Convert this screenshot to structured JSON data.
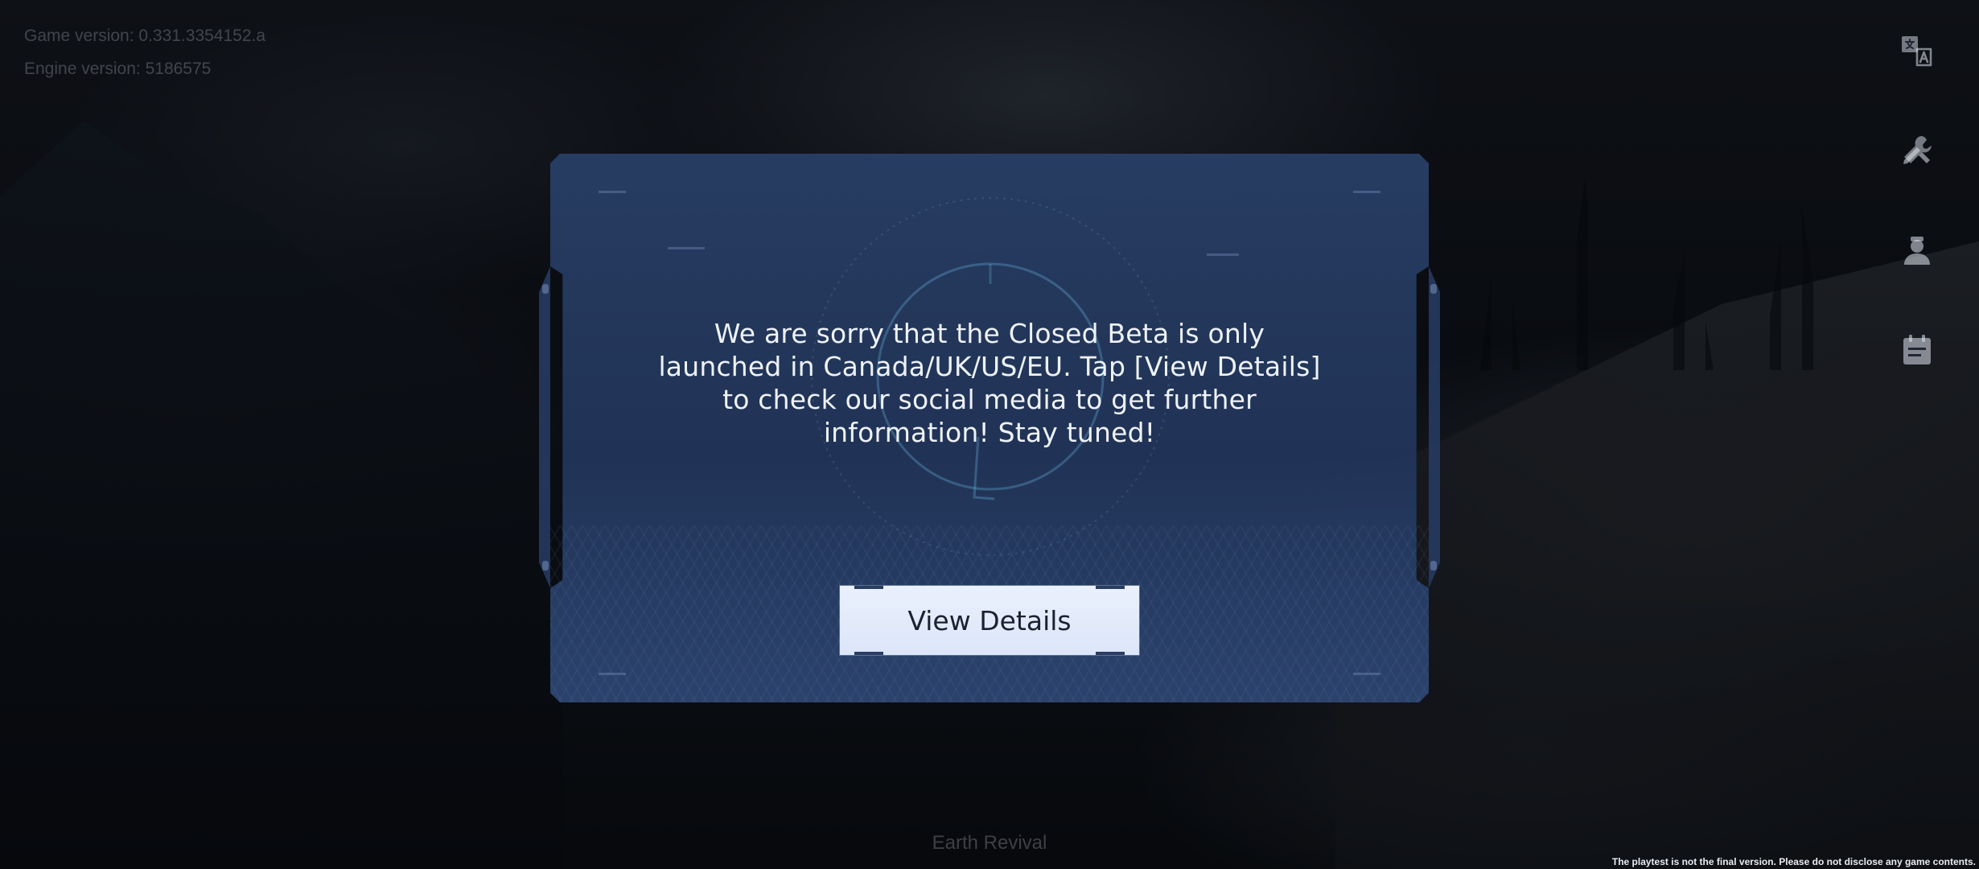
{
  "background": {
    "description_icon": "snowy-mountain-scene"
  },
  "version_info": {
    "game_version": "Game version: 0.331.3354152.a",
    "engine_version": "Engine version: 5186575"
  },
  "side_icons": [
    {
      "name": "language-icon"
    },
    {
      "name": "tools-icon"
    },
    {
      "name": "user-icon"
    },
    {
      "name": "notice-icon"
    }
  ],
  "dialog": {
    "message": "We are sorry that the Closed Beta is only launched in Canada/UK/US/EU. Tap [View Details] to check our social media to get further information! Stay tuned!",
    "button_label": "View Details"
  },
  "footer": {
    "game_title": "Earth Revival",
    "disclaimer": "The playtest is not the final version. Please do not disclose any game contents."
  },
  "colors": {
    "dialog_bg": "#223459",
    "button_bg": "#e4ecfb",
    "button_text": "#1b2130",
    "message_text": "#eef2f8"
  }
}
